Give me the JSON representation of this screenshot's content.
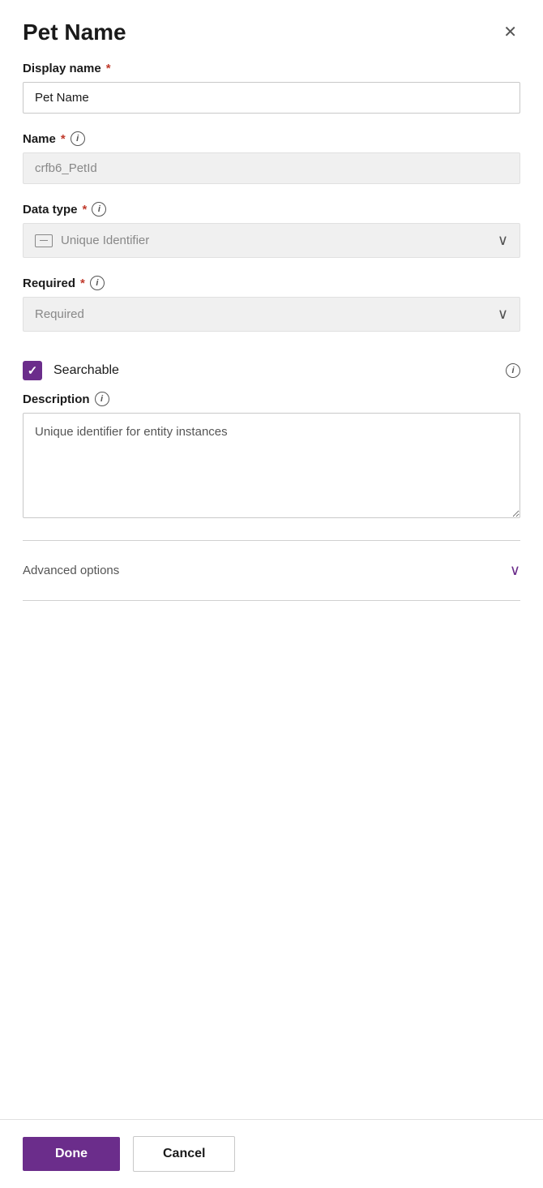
{
  "panel": {
    "title": "Pet Name",
    "close_label": "×"
  },
  "fields": {
    "display_name": {
      "label": "Display name",
      "required": true,
      "value": "Pet Name",
      "placeholder": "Pet Name"
    },
    "name": {
      "label": "Name",
      "required": true,
      "info": "i",
      "value": "crfb6_PetId",
      "placeholder": "crfb6_PetId"
    },
    "data_type": {
      "label": "Data type",
      "required": true,
      "info": "i",
      "value": "Unique Identifier",
      "icon_text": "—"
    },
    "required_field": {
      "label": "Required",
      "required": true,
      "info": "i",
      "value": "Required",
      "placeholder": "Required"
    },
    "searchable": {
      "label": "Searchable",
      "checked": true,
      "info": "i"
    },
    "description": {
      "label": "Description",
      "info": "i",
      "value": "Unique identifier for entity instances",
      "placeholder": ""
    }
  },
  "advanced": {
    "label": "Advanced options",
    "chevron": "∨"
  },
  "footer": {
    "done_label": "Done",
    "cancel_label": "Cancel"
  },
  "icons": {
    "info": "i",
    "close": "✕",
    "check": "✓",
    "chevron_down": "∨"
  }
}
